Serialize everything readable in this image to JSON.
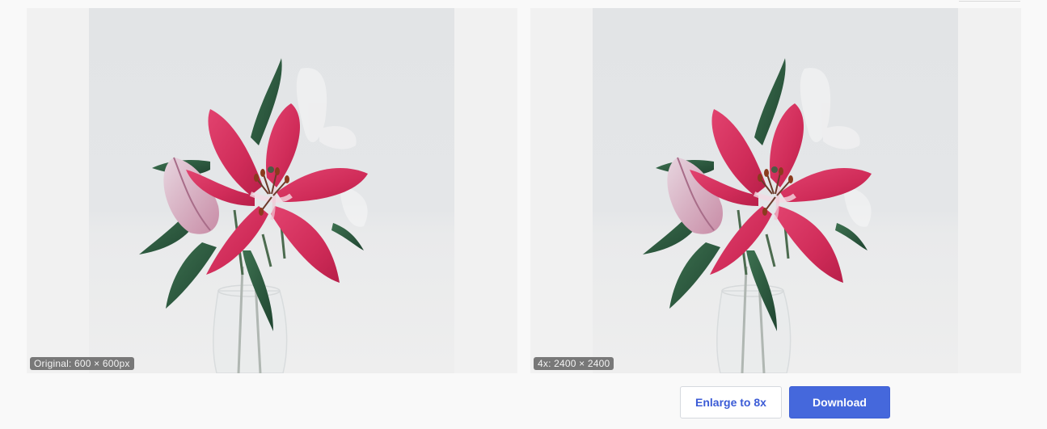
{
  "comparison": {
    "original": {
      "label": "Original: 600 × 600px",
      "image": "pink-lily-bouquet"
    },
    "upscaled": {
      "label": "4x: 2400 × 2400",
      "image": "pink-lily-bouquet"
    }
  },
  "actions": {
    "enlarge_label": "Enlarge to 8x",
    "download_label": "Download"
  },
  "colors": {
    "accent": "#4568dc",
    "accent_text": "#3b5bd6",
    "petal_pink": "#d8335f",
    "leaf_green": "#2e5a3c"
  }
}
